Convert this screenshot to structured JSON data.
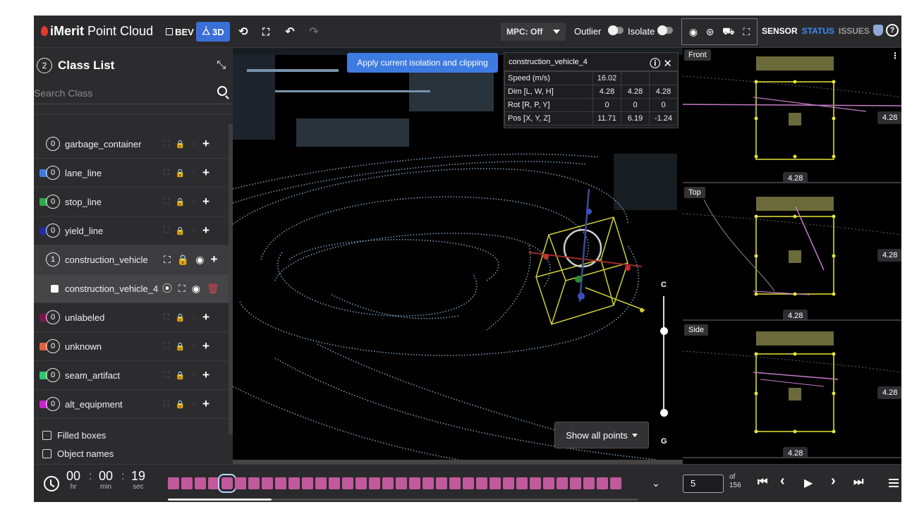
{
  "app": {
    "brand_bold": "iMerit",
    "brand_rest": " Point Cloud"
  },
  "toolbar": {
    "bev_label": "BEV",
    "threed_label": "3D",
    "mpc_label": "MPC: Off",
    "outlier_label": "Outlier",
    "isolate_label": "Isolate",
    "tabs": [
      "SENSOR",
      "STATUS",
      "ISSUES"
    ],
    "accent": "#3a6fd8"
  },
  "class_list": {
    "count": "2",
    "title": "Class List",
    "search_placeholder": "Search Class",
    "items": [
      {
        "count": "0",
        "label": "garbage_container",
        "color": ""
      },
      {
        "count": "0",
        "label": "lane_line",
        "color": "#3d7be0"
      },
      {
        "count": "0",
        "label": "stop_line",
        "color": "#2ea84a"
      },
      {
        "count": "0",
        "label": "yield_line",
        "color": "#1f2f9e"
      },
      {
        "count": "1",
        "label": "construction_vehicle",
        "color": ""
      },
      {
        "count": "",
        "label": "construction_vehicle_4",
        "color": "#ffffff"
      },
      {
        "count": "0",
        "label": "unlabeled",
        "color": "#7a1550"
      },
      {
        "count": "0",
        "label": "unknown",
        "color": "#e2603a"
      },
      {
        "count": "0",
        "label": "seam_artifact",
        "color": "#2ec66a"
      },
      {
        "count": "0",
        "label": "alt_equipment",
        "color": "#cc22cc"
      }
    ],
    "filled_boxes": "Filled boxes",
    "object_names": "Object names"
  },
  "viewport": {
    "apply_label": "Apply current isolation and clipping",
    "show_points_label": "Show all points",
    "slider_top": "C",
    "slider_bottom": "G"
  },
  "info_panel": {
    "title": "construction_vehicle_4",
    "speed_label": "Speed (m/s)",
    "speed_value": "16.02",
    "dim_label": "Dim [L, W, H]",
    "dim_values": [
      "4.28",
      "4.28",
      "4.28"
    ],
    "rot_label": "Rot [R, P, Y]",
    "rot_values": [
      "0",
      "0",
      "0"
    ],
    "pos_label": "Pos [X, Y, Z]",
    "pos_values": [
      "11.71",
      "6.19",
      "-1.24"
    ]
  },
  "views": [
    {
      "name": "Front",
      "right_dim": "4.28",
      "bottom_dim": "4.28"
    },
    {
      "name": "Top",
      "right_dim": "4.28",
      "bottom_dim": "4.28"
    },
    {
      "name": "Side",
      "right_dim": "4.28",
      "bottom_dim": "4.28"
    }
  ],
  "timeline": {
    "hr": "00",
    "min": "00",
    "sec": "19",
    "hr_label": "hr",
    "min_label": "min",
    "sec_label": "sec",
    "frame_current": "5",
    "of_label": "of",
    "frame_total": "156",
    "frame_color": "#c2599c",
    "scroll_fraction": 0.22
  }
}
